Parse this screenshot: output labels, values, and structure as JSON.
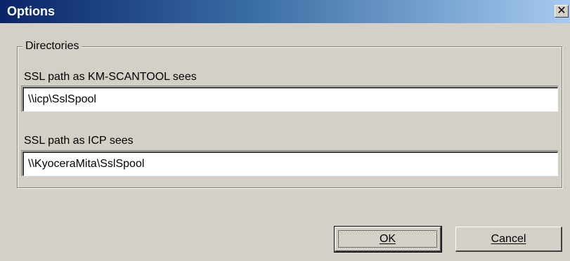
{
  "window": {
    "title": "Options",
    "close_glyph": "✕"
  },
  "group": {
    "label": "Directories"
  },
  "fields": {
    "scantool_label": "SSL path as KM-SCANTOOL sees",
    "scantool_value": "\\\\icp\\SslSpool",
    "icp_label": "SSL path as ICP sees",
    "icp_value": "\\\\KyoceraMita\\SslSpool"
  },
  "buttons": {
    "ok_label": "OK",
    "cancel_label": "Cancel"
  },
  "colors": {
    "title_bar_start": "#0a246a",
    "title_bar_end": "#a6caf0",
    "dialog_face": "#d4d0c8"
  },
  "icons": {
    "close": "close-icon"
  }
}
